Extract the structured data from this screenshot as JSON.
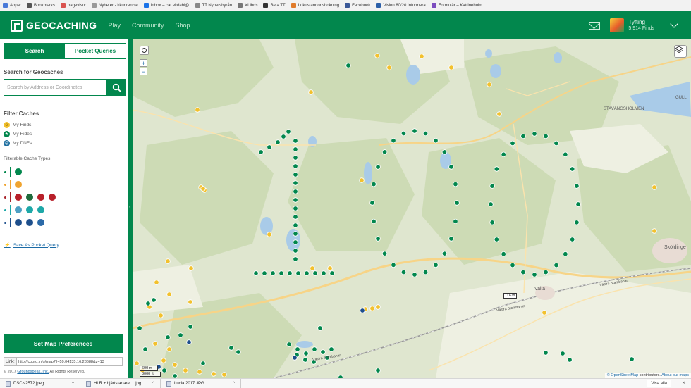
{
  "bookmarks": [
    "Appar",
    "Bookmarks",
    "pagevisor",
    "Nyheter - kkuriren.se",
    "Inbox – car.ekdahl@",
    "TT Nyhetsbyrån",
    "XLibris",
    "Beta TT",
    "Lokus annonsbokning",
    "Facebook",
    "Vision 80/20 Informera",
    "Formulär – Katrineholm"
  ],
  "header": {
    "logo": "GEOCACHING",
    "nav": [
      "Play",
      "Community",
      "Shop"
    ],
    "user_name": "Tyfting",
    "user_finds": "5,914 Finds"
  },
  "sidebar": {
    "tabs": [
      "Search",
      "Pocket Queries"
    ],
    "search_title": "Search for Geocaches",
    "search_placeholder": "Search by Address or Coordinates",
    "filter_title": "Filter Caches",
    "filters": [
      "My Finds",
      "My Hides",
      "My DNFs"
    ],
    "types_label": "Filterable Cache Types",
    "save_pq": "Save As Pocket Query",
    "prefs_button": "Set Map Preferences",
    "link_label": "Link:",
    "link_value": "http://coord.info/map?ll=59.04135,16.28688&z=13",
    "copyright_prefix": "© 2017",
    "copyright_company": "Groundspeak, Inc.",
    "copyright_suffix": "All Rights Reserved."
  },
  "map": {
    "places": [
      "STAVÄNGSHOLMEN",
      "GULLI",
      "Sköldinge",
      "Valla"
    ],
    "roads": [
      "D 678",
      "Västra Stambanan",
      "Västra Stambanan",
      "Västra Stambanan"
    ],
    "zoom_in": "+",
    "zoom_out": "−",
    "scale_m": "600 m",
    "scale_ft": "3000 ft",
    "attribution_leaflet": "© OpenStreetMap",
    "attribution_mid": "contributors.",
    "attribution_link": "About our maps",
    "colors": {
      "traditional": "#02874d",
      "found": "#f2c12e",
      "mystery": "#1e4f8c"
    }
  },
  "downloads": {
    "files": [
      "DSCN2572.jpeg",
      "HLR + hjärtstartare ....jpg",
      "Lucia 2017.JPG"
    ],
    "show_all": "Visa alla"
  }
}
